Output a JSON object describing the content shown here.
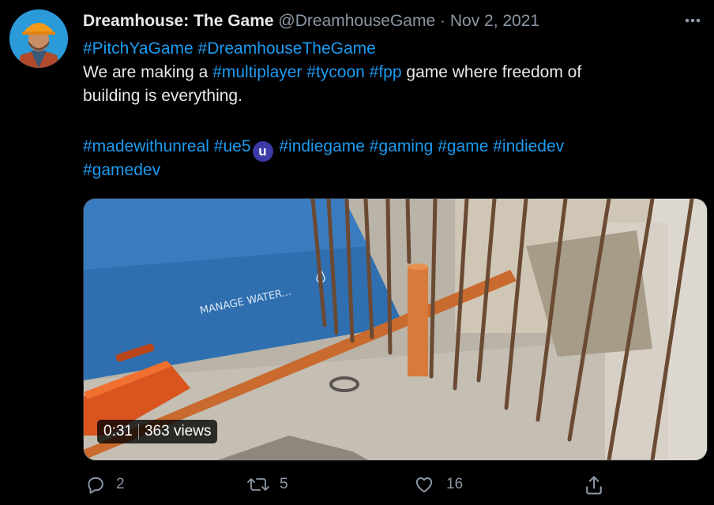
{
  "tweet": {
    "author_name": "Dreamhouse: The Game",
    "author_handle": "@DreamhouseGame",
    "separator": "·",
    "date": "Nov 2, 2021",
    "avatar_icon": "avatar-construction-worker",
    "more_icon": "ellipsis-icon",
    "text": {
      "line1_tags": [
        "#PitchYaGame",
        "#DreamhouseTheGame"
      ],
      "line2_prefix": "We are making a",
      "line2_tags": [
        "#multiplayer",
        "#tycoon",
        "#fpp"
      ],
      "line2_suffix": "game where freedom of",
      "line3": "building is everything.",
      "line4_tags_a": [
        "#madewithunreal",
        "#ue5"
      ],
      "line4_badge": "u",
      "line4_tags_b": [
        "#indiegame",
        "#gaming",
        "#game",
        "#indiedev"
      ],
      "line5_tags": [
        "#gamedev"
      ]
    },
    "media": {
      "overlay_text": "MANAGE WATER...",
      "duration": "0:31",
      "views": "363 views"
    },
    "actions": {
      "reply_count": "2",
      "retweet_count": "5",
      "like_count": "16",
      "reply_icon": "reply-icon",
      "retweet_icon": "retweet-icon",
      "like_icon": "heart-icon",
      "share_icon": "share-icon"
    },
    "colors": {
      "background": "#000000",
      "text": "#e7e9ea",
      "muted": "#8b98a5",
      "link": "#1d9bf0",
      "ue_badge": "#3d3aa8"
    }
  }
}
